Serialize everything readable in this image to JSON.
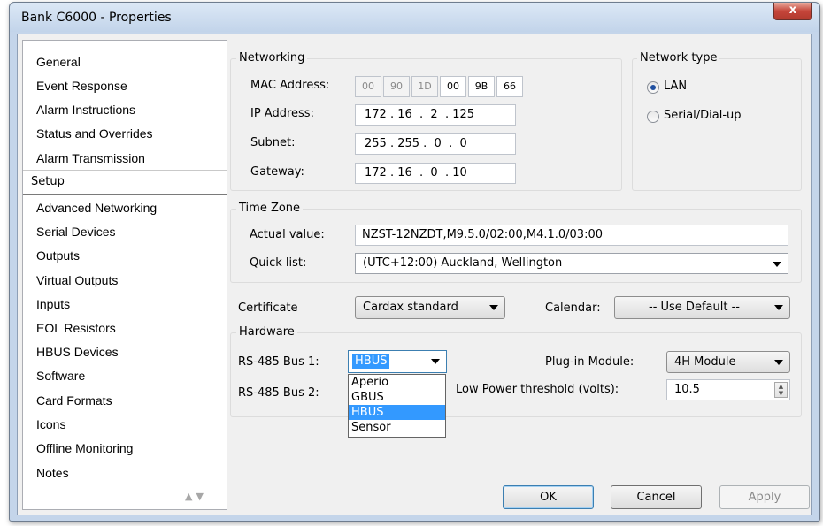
{
  "window": {
    "title": "Bank C6000 - Properties",
    "close_glyph": "x"
  },
  "sidebar": {
    "items": [
      {
        "label": "General"
      },
      {
        "label": "Event Response"
      },
      {
        "label": "Alarm Instructions"
      },
      {
        "label": "Status and Overrides"
      },
      {
        "label": "Alarm Transmission"
      },
      {
        "label": "Setup",
        "selected": true
      },
      {
        "label": "Advanced Networking"
      },
      {
        "label": "Serial Devices"
      },
      {
        "label": "Outputs"
      },
      {
        "label": "Virtual Outputs"
      },
      {
        "label": "Inputs"
      },
      {
        "label": "EOL Resistors"
      },
      {
        "label": "HBUS Devices"
      },
      {
        "label": "Software"
      },
      {
        "label": "Card Formats"
      },
      {
        "label": "Icons"
      },
      {
        "label": "Offline Monitoring"
      },
      {
        "label": "Notes"
      }
    ],
    "scroll_glyphs": "▲▼"
  },
  "networking": {
    "group_label": "Networking",
    "mac_label": "MAC Address:",
    "mac_octets": [
      "00",
      "90",
      "1D",
      "00",
      "9B",
      "66"
    ],
    "ip_label": "IP Address:",
    "ip_value": "172 . 16  .  2  . 125",
    "subnet_label": "Subnet:",
    "subnet_value": "255 . 255 .  0  .  0",
    "gateway_label": "Gateway:",
    "gateway_value": "172 . 16  .  0  . 10"
  },
  "network_type": {
    "group_label": "Network type",
    "options": [
      {
        "label": "LAN",
        "checked": true
      },
      {
        "label": "Serial/Dial-up",
        "checked": false
      }
    ]
  },
  "time_zone": {
    "group_label": "Time Zone",
    "actual_label": "Actual value:",
    "actual_value": "NZST-12NZDT,M9.5.0/02:00,M4.1.0/03:00",
    "quick_label": "Quick list:",
    "quick_value": "(UTC+12:00) Auckland, Wellington"
  },
  "certificate": {
    "label": "Certificate",
    "value": "Cardax standard"
  },
  "calendar": {
    "label": "Calendar:",
    "value": "-- Use Default --"
  },
  "hardware": {
    "group_label": "Hardware",
    "bus1_label": "RS-485 Bus 1:",
    "bus1_value": "HBUS",
    "bus2_label": "RS-485 Bus 2:",
    "bus_options": [
      "Aperio",
      "GBUS",
      "HBUS",
      "Sensor"
    ],
    "bus_options_highlighted": "HBUS",
    "plugin_label": "Plug-in Module:",
    "plugin_value": "4H Module",
    "low_power_label": "Low Power threshold (volts):",
    "low_power_value": "10.5"
  },
  "buttons": {
    "ok": "OK",
    "cancel": "Cancel",
    "apply": "Apply"
  }
}
